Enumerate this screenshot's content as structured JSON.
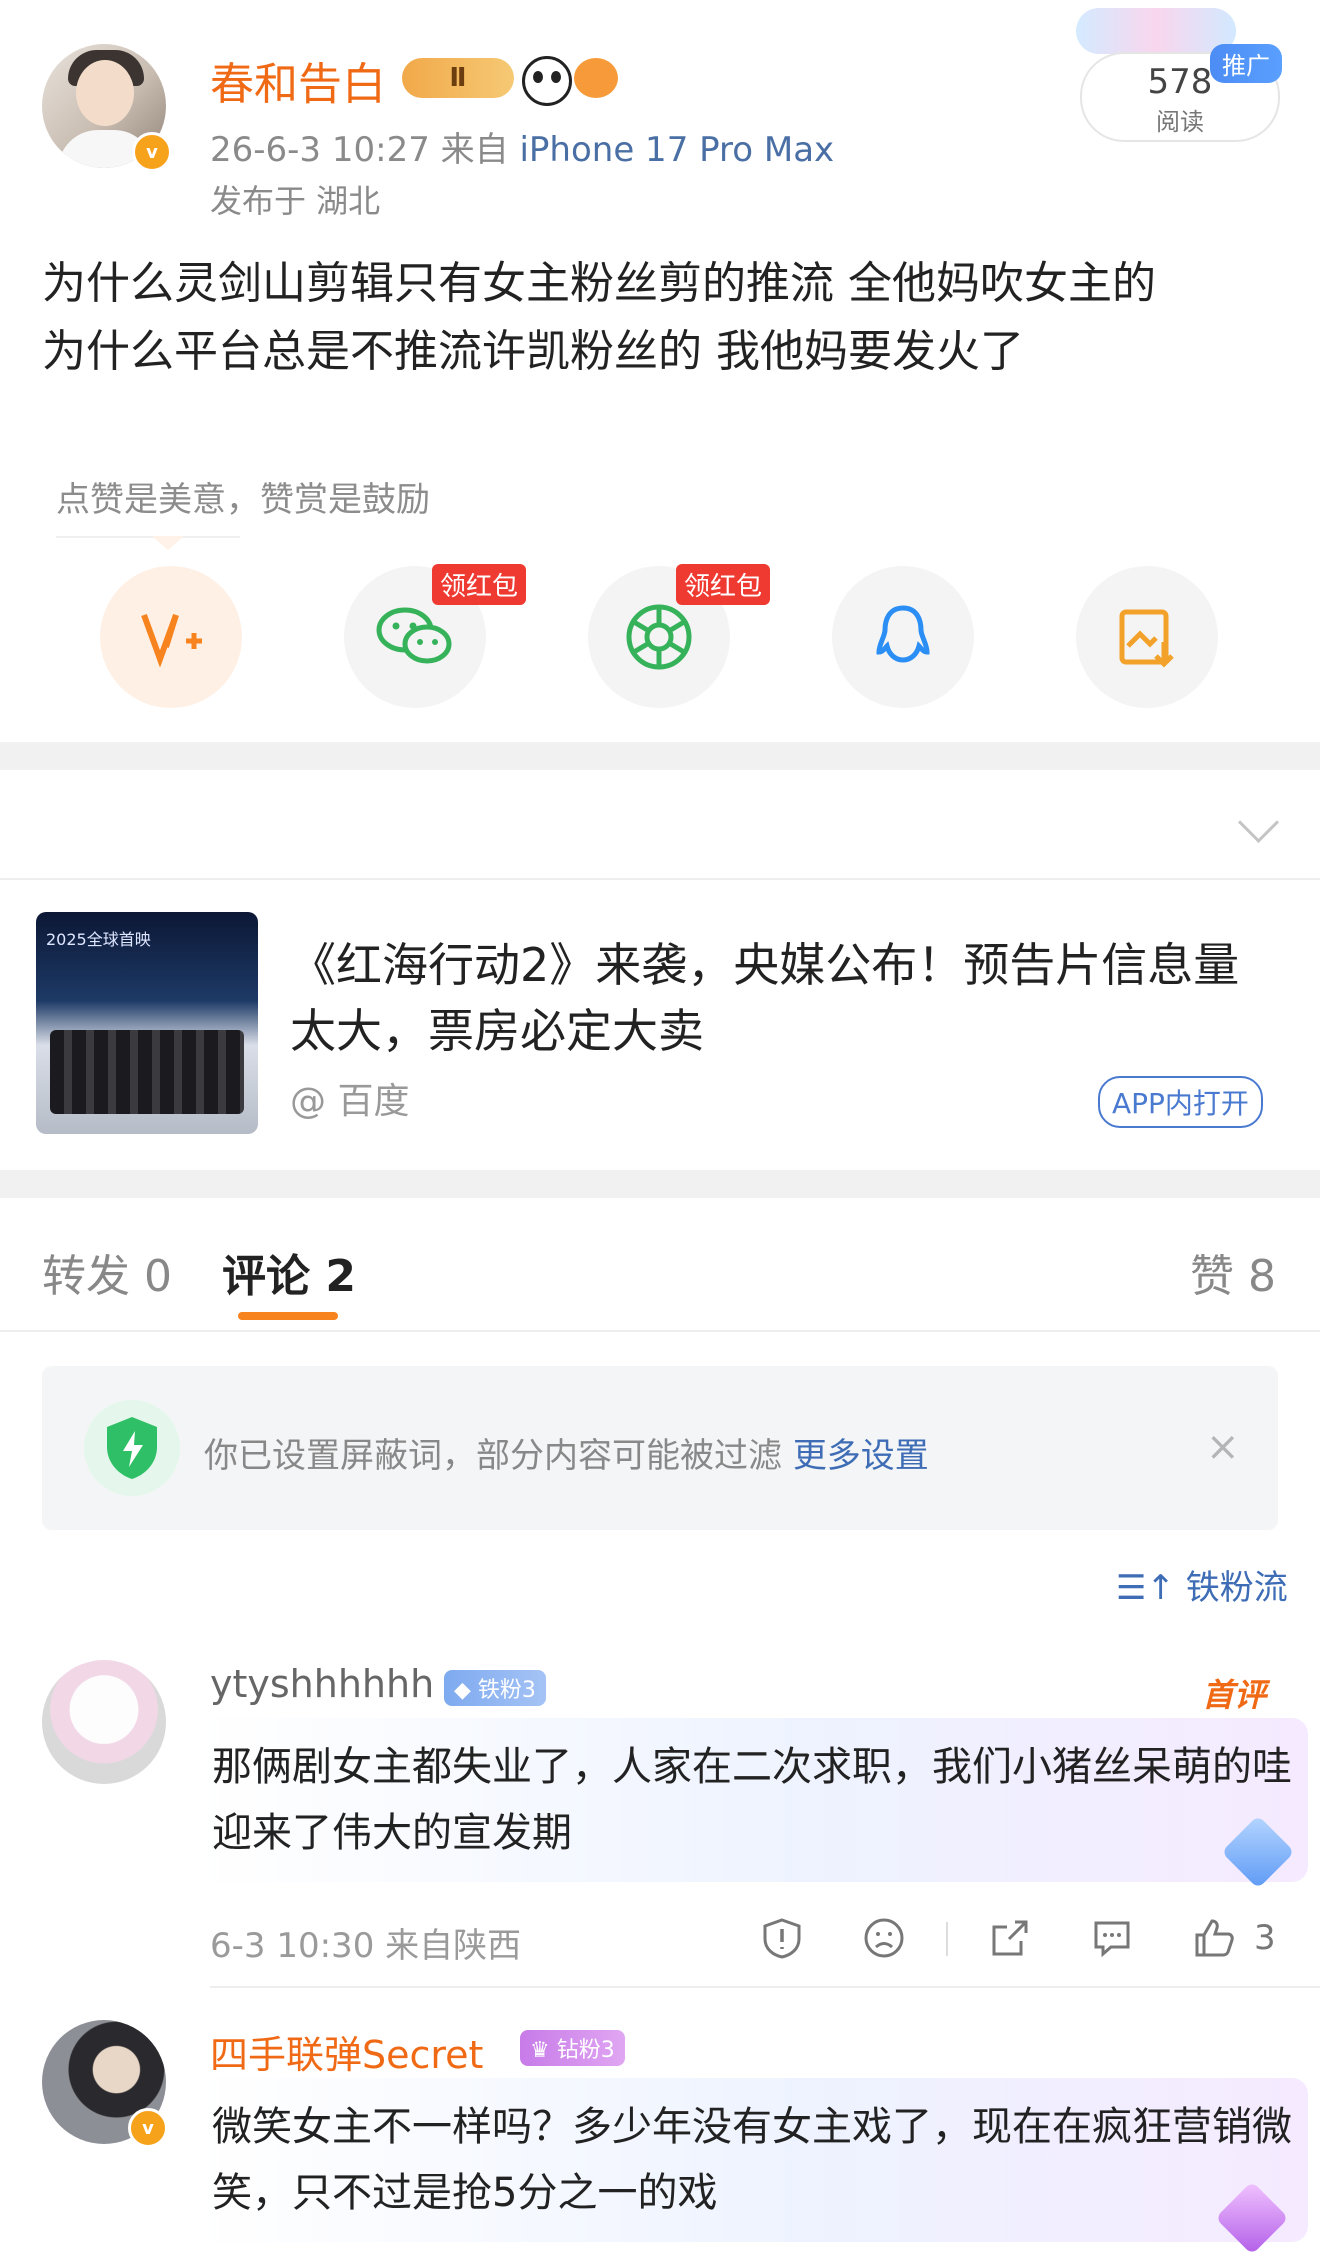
{
  "post": {
    "username": "春和告白",
    "level_badge": "Ⅱ",
    "timestamp": "26-6-3 10:27",
    "source_prefix": "来自",
    "device": "iPhone 17 Pro Max",
    "location": "发布于 湖北",
    "read_count": "578",
    "read_label": "阅读",
    "promo_tag": "推广",
    "text": "为什么灵剑山剪辑只有女主粉丝剪的推流 全他妈吹女主的\n为什么平台总是不推流许凯粉丝的 我他妈要发火了"
  },
  "appreciation": {
    "tip": "点赞是美意，赞赏是鼓励",
    "red_packet_tag": "领红包",
    "buttons": [
      "reward",
      "wechat",
      "moments",
      "qq",
      "save-image"
    ]
  },
  "news_card": {
    "thumb_caption": "2025全球首映",
    "title": "《红海行动2》来袭，央媒公布！预告片信息量太大，票房必定大卖",
    "source": "@ 百度",
    "open_label": "APP内打开"
  },
  "tabs": {
    "repost": "转发 0",
    "comment": "评论 2",
    "like": "赞 8"
  },
  "filter_notice": {
    "text": "你已设置屏蔽词，部分内容可能被过滤",
    "link": "更多设置",
    "close": "×"
  },
  "sort_label": "铁粉流",
  "comments": [
    {
      "username": "ytyshhhhhh",
      "fan_badge": "铁粉3",
      "first_tag": "首评",
      "text": "那俩剧女主都失业了，人家在二次求职，我们小猪丝呆萌的哇迎来了伟大的宣发期",
      "meta": "6-3 10:30 来自陕西",
      "likes": "3",
      "username_color": "#666666"
    },
    {
      "username": "四手联弹Secret",
      "fan_badge": "钻粉3",
      "text": "微笑女主不一样吗？多少年没有女主戏了，现在在疯狂营销微笑，只不过是抢5分之一的戏",
      "username_color": "#f06a16"
    }
  ],
  "colors": {
    "brand_orange": "#f06a16",
    "link_blue": "#3e6db6",
    "red_tag": "#ef3a32"
  }
}
